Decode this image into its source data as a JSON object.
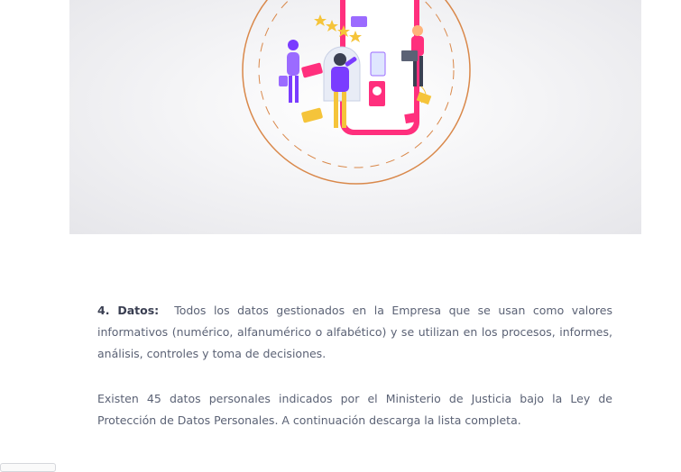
{
  "hero": {
    "illustration": "phone-rating-people-illustration",
    "accent_colors": {
      "pink": "#ff2f7d",
      "purple": "#7a3cff",
      "gold": "#f5c43a",
      "orange": "#d9884a"
    }
  },
  "article": {
    "section_label": "4. Datos:",
    "paragraph1": "Todos los datos gestionados en la Empresa que se usan como valores informativos (numérico, alfanumérico o alfabético) y se utilizan en los procesos, informes, análisis, controles y toma de decisiones.",
    "paragraph2": "Existen 45 datos personales indicados por el Ministerio de Justicia bajo la Ley de Protección de Datos Personales. A continuación descarga la lista completa."
  }
}
